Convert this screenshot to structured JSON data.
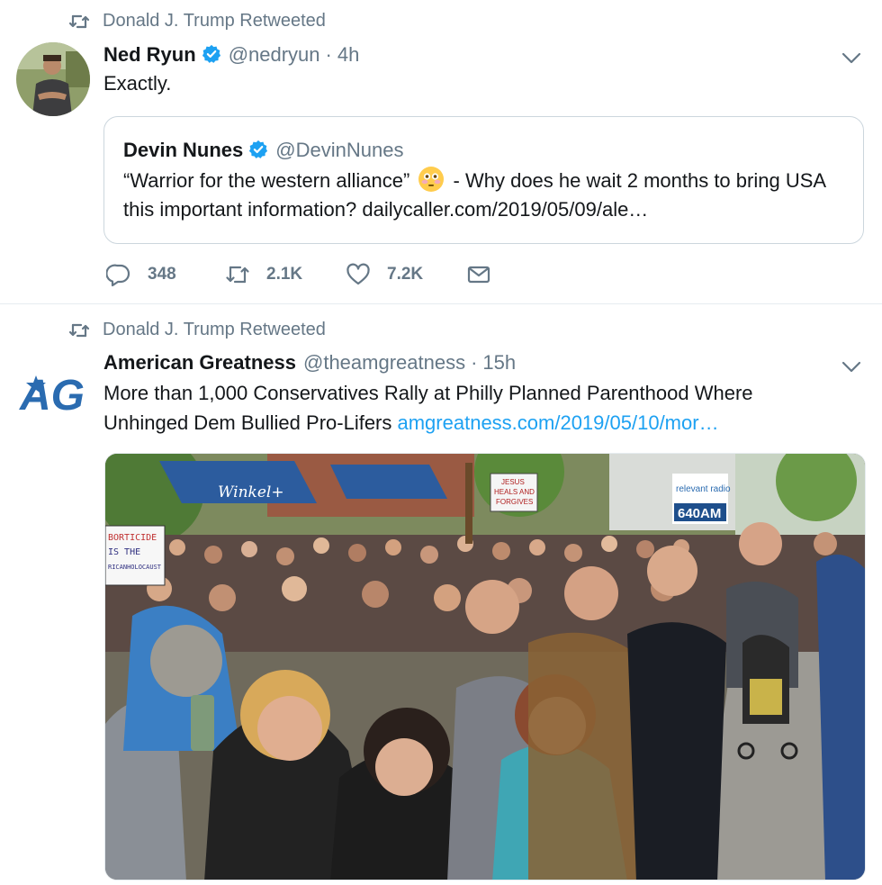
{
  "retweet_label": "Donald J. Trump Retweeted",
  "tweets": [
    {
      "name": "Ned Ryun",
      "handle": "@nedryun",
      "separator": "·",
      "time": "4h",
      "text": "Exactly.",
      "quote": {
        "name": "Devin Nunes",
        "handle": "@DevinNunes",
        "text_before": "“Warrior for the western alliance”",
        "emoji": "flushed-face",
        "text_after": "- Why does he wait 2 months to bring USA this important information?  dailycaller.com/2019/05/09/ale…"
      },
      "actions": {
        "replies": "348",
        "retweets": "2.1K",
        "likes": "7.2K"
      }
    },
    {
      "name": "American Greatness",
      "handle": "@theamgreatness",
      "separator": "·",
      "time": "15h",
      "text": "More than 1,000 Conservatives Rally at Philly Planned Parenthood Where Unhinged Dem Bullied Pro-Lifers",
      "link": "amgreatness.com/2019/05/10/mor…",
      "logo_text": "AG",
      "photo": {
        "sign_left": [
          "BORTICIDE",
          "IS THE",
          "RICANHOLOCAUST"
        ],
        "sign_jesus": [
          "JESUS",
          "HEALS AND",
          "FORGIVES"
        ],
        "awning": "Winkel+",
        "radio_brand": "relevant radio",
        "radio_freq": "640AM"
      }
    }
  ],
  "colors": {
    "verified": "#1da1f2",
    "link": "#1da1f2",
    "muted": "#657786",
    "border": "#e6ecf0",
    "ag_blue": "#2a6bb0"
  },
  "icons": [
    "retweet-icon",
    "verified-badge-icon",
    "chevron-down-icon",
    "reply-icon",
    "heart-icon",
    "mail-icon"
  ]
}
